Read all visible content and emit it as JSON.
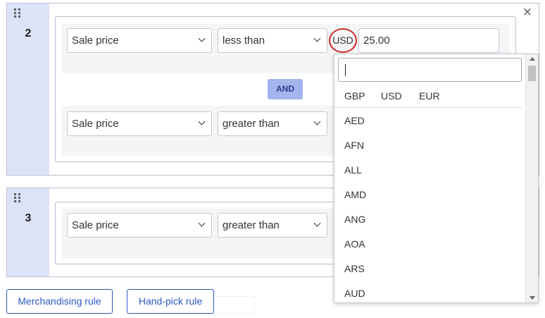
{
  "rules": [
    {
      "number": "2",
      "conditions": [
        {
          "field": "Sale price",
          "operator": "less than"
        },
        {
          "field": "Sale price",
          "operator": "greater than"
        }
      ],
      "join_label": "AND"
    },
    {
      "number": "3",
      "conditions": [
        {
          "field": "Sale price",
          "operator": "greater than"
        }
      ]
    }
  ],
  "price": {
    "currency": "USD",
    "value": "25.00"
  },
  "currency_dropdown": {
    "search_value": "",
    "quick": [
      "GBP",
      "USD",
      "EUR"
    ],
    "options": [
      "AED",
      "AFN",
      "ALL",
      "AMD",
      "ANG",
      "AOA",
      "ARS",
      "AUD"
    ]
  },
  "buttons": {
    "merch": "Merchandising rule",
    "handpick": "Hand-pick rule"
  },
  "close_glyph": "×",
  "colors": {
    "accent": "#2b58c4",
    "highlight_ring": "#d12929",
    "side_panel": "#dde3f6",
    "and_button": "#a6b4ee"
  }
}
